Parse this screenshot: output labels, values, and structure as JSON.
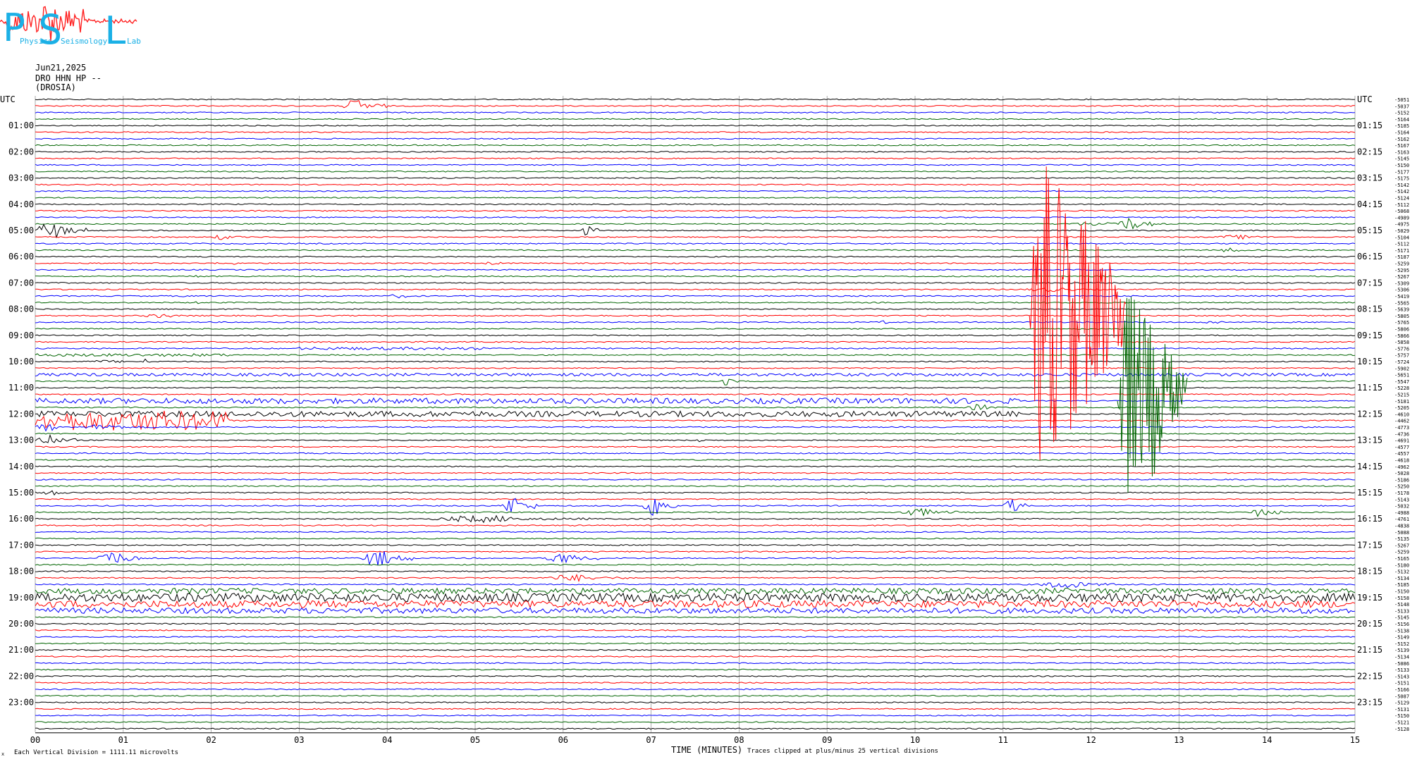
{
  "logo": {
    "big_letters": [
      "P",
      "S",
      "L"
    ],
    "small_words": [
      "Physics",
      "Seismology",
      "Lab"
    ],
    "colors": {
      "letters": "#1ab0e6",
      "trace": "#ff2020"
    }
  },
  "header": {
    "date": "Jun21,2025",
    "station": "DRO HHN HP --",
    "location": "(DROSIA)",
    "utc_left": "UTC",
    "utc_right": "UTC"
  },
  "footer": {
    "left_note": "Each Vertical Division = 1111.11 microvolts",
    "x_title": "TIME (MINUTES)",
    "clip_note": "Traces clipped at plus/minus 25 vertical divisions",
    "corner_mark": "x"
  },
  "chart_data": {
    "type": "line",
    "title": "",
    "xlabel": "TIME (MINUTES)",
    "xlim": [
      0,
      15
    ],
    "x_ticks": [
      "00",
      "01",
      "02",
      "03",
      "04",
      "05",
      "06",
      "07",
      "08",
      "09",
      "10",
      "11",
      "12",
      "13",
      "14",
      "15"
    ],
    "rows_per_hour": 4,
    "row_minutes": 15,
    "left_hour_labels": [
      "UTC",
      "01:00",
      "02:00",
      "03:00",
      "04:00",
      "05:00",
      "06:00",
      "07:00",
      "08:00",
      "09:00",
      "10:00",
      "11:00",
      "12:00",
      "13:00",
      "14:00",
      "15:00",
      "16:00",
      "17:00",
      "18:00",
      "19:00",
      "20:00",
      "21:00",
      "22:00",
      "23:00"
    ],
    "right_hour_labels": [
      "UTC",
      "01:15",
      "02:15",
      "03:15",
      "04:15",
      "05:15",
      "06:15",
      "07:15",
      "08:15",
      "09:15",
      "10:15",
      "11:15",
      "12:15",
      "13:15",
      "14:15",
      "15:15",
      "16:15",
      "17:15",
      "18:15",
      "19:15",
      "20:15",
      "21:15",
      "22:15",
      "23:15"
    ],
    "trace_colors": [
      "#000000",
      "#ff0000",
      "#0000ff",
      "#006400"
    ],
    "right_offsets": [
      "-5051",
      "-5037",
      "-5152",
      "-5164",
      "-5185",
      "-5164",
      "-5162",
      "-5167",
      "-5163",
      "-5145",
      "-5150",
      "-5177",
      "-5175",
      "-5142",
      "-5142",
      "-5124",
      "-5112",
      "-5068",
      "-4989",
      "-4975",
      "-5029",
      "-5104",
      "-5112",
      "-5171",
      "-5187",
      "-5259",
      "-5295",
      "-5267",
      "-5309",
      "-5306",
      "-5419",
      "-5565",
      "-5639",
      "-5805",
      "-5765",
      "-5806",
      "-5866",
      "-5858",
      "-5776",
      "-5757",
      "-5724",
      "-5902",
      "-5651",
      "-5547",
      "-5228",
      "-5215",
      "-5181",
      "-5205",
      "-4610",
      "-4462",
      "-4773",
      "-4736",
      "-4691",
      "-4577",
      "-4557",
      "-4618",
      "-4962",
      "-5028",
      "-5186",
      "-5250",
      "-5178",
      "-5143",
      "-5032",
      "-4988",
      "-4761",
      "-4838",
      "-5088",
      "-5135",
      "-5267",
      "-5259",
      "-5165",
      "-5180",
      "-5132",
      "-5134",
      "-5185",
      "-5150",
      "-5158",
      "-5148",
      "-5133",
      "-5145",
      "-5156",
      "-5138",
      "-5149",
      "-5152",
      "-5139",
      "-5134",
      "-5086",
      "-5133",
      "-5143",
      "-5151",
      "-5166",
      "-5087",
      "-5129",
      "-5131",
      "-5150",
      "-5121",
      "-5128"
    ],
    "events": [
      {
        "row": 1,
        "start": 3.5,
        "end": 4.0,
        "amp": 10
      },
      {
        "row": 12,
        "start": 7.6,
        "end": 7.9,
        "amp": 1.2
      },
      {
        "row": 19,
        "start": 11.7,
        "end": 13.0,
        "amp": 3
      },
      {
        "row": 19,
        "start": 12.3,
        "end": 12.7,
        "amp": 10
      },
      {
        "row": 20,
        "start": 0.0,
        "end": 0.6,
        "amp": 12
      },
      {
        "row": 20,
        "start": 6.2,
        "end": 6.4,
        "amp": 9
      },
      {
        "row": 21,
        "start": 2.0,
        "end": 2.4,
        "amp": 4
      },
      {
        "row": 21,
        "start": 13.4,
        "end": 14.3,
        "amp": 3
      },
      {
        "row": 22,
        "start": 8.5,
        "end": 8.6,
        "amp": 2
      },
      {
        "row": 23,
        "start": 13.4,
        "end": 14.0,
        "amp": 3
      },
      {
        "row": 25,
        "start": 2.0,
        "end": 2.6,
        "amp": 2
      },
      {
        "row": 25,
        "start": 5.0,
        "end": 5.6,
        "amp": 2
      },
      {
        "row": 27,
        "start": 1.7,
        "end": 2.0,
        "amp": 2
      },
      {
        "row": 29,
        "start": 11.2,
        "end": 12.3,
        "amp": 3
      },
      {
        "row": 30,
        "start": 1.6,
        "end": 1.8,
        "amp": 2
      },
      {
        "row": 30,
        "start": 4.0,
        "end": 4.4,
        "amp": 3
      },
      {
        "row": 31,
        "start": 1.8,
        "end": 1.9,
        "amp": 3
      },
      {
        "row": 33,
        "start": 1.2,
        "end": 1.9,
        "amp": 3
      },
      {
        "row": 34,
        "start": 9.6,
        "end": 9.8,
        "amp": 3
      },
      {
        "row": 34,
        "start": 13.2,
        "end": 13.8,
        "amp": 2
      },
      {
        "row": 38,
        "start": 3.0,
        "end": 5.1,
        "amp": 2
      },
      {
        "row": 39,
        "start": 0.0,
        "end": 2.2,
        "amp": 2
      },
      {
        "row": 40,
        "start": 0.5,
        "end": 1.5,
        "amp": 2
      },
      {
        "row": 40,
        "start": 1.2,
        "end": 1.4,
        "amp": 4
      },
      {
        "row": 42,
        "start": 0.0,
        "end": 15.0,
        "amp": 2
      },
      {
        "row": 43,
        "start": 7.8,
        "end": 8.0,
        "amp": 7
      },
      {
        "row": 46,
        "start": 0.0,
        "end": 11.2,
        "amp": 4
      },
      {
        "row": 47,
        "start": 10.6,
        "end": 11.0,
        "amp": 5
      },
      {
        "row": 48,
        "start": 0.0,
        "end": 11.2,
        "amp": 4
      },
      {
        "row": 49,
        "start": 0.0,
        "end": 2.2,
        "amp": 14
      },
      {
        "row": 50,
        "start": 0.0,
        "end": 0.4,
        "amp": 6
      },
      {
        "row": 50,
        "start": 0.5,
        "end": 1.4,
        "amp": 4
      },
      {
        "row": 52,
        "start": 0.0,
        "end": 0.5,
        "amp": 8
      },
      {
        "row": 52,
        "start": 7.5,
        "end": 7.7,
        "amp": 3
      },
      {
        "row": 60,
        "start": 0.0,
        "end": 0.5,
        "amp": 4
      },
      {
        "row": 62,
        "start": 5.3,
        "end": 5.7,
        "amp": 14
      },
      {
        "row": 62,
        "start": 6.9,
        "end": 7.3,
        "amp": 16
      },
      {
        "row": 62,
        "start": 11.0,
        "end": 11.3,
        "amp": 10
      },
      {
        "row": 63,
        "start": 9.8,
        "end": 10.5,
        "amp": 6
      },
      {
        "row": 63,
        "start": 13.8,
        "end": 14.2,
        "amp": 8
      },
      {
        "row": 64,
        "start": 4.5,
        "end": 6.3,
        "amp": 5
      },
      {
        "row": 70,
        "start": 0.7,
        "end": 1.2,
        "amp": 12
      },
      {
        "row": 70,
        "start": 3.7,
        "end": 4.3,
        "amp": 12
      },
      {
        "row": 70,
        "start": 5.8,
        "end": 6.4,
        "amp": 8
      },
      {
        "row": 73,
        "start": 5.8,
        "end": 6.8,
        "amp": 5
      },
      {
        "row": 74,
        "start": 11.4,
        "end": 12.3,
        "amp": 6
      },
      {
        "row": 75,
        "start": 0.0,
        "end": 15.0,
        "amp": 4
      },
      {
        "row": 76,
        "start": 0.0,
        "end": 15.0,
        "amp": 6
      },
      {
        "row": 77,
        "start": 0.0,
        "end": 15.0,
        "amp": 5
      },
      {
        "row": 78,
        "start": 0.0,
        "end": 15.0,
        "amp": 4
      }
    ],
    "clipped_bursts": [
      {
        "row": 33,
        "start": 11.3,
        "end": 12.4,
        "color": "#ff0000",
        "clip_rows": 25
      },
      {
        "row": 46,
        "start": 12.3,
        "end": 13.1,
        "color": "#006400",
        "clip_rows": 18
      }
    ]
  }
}
